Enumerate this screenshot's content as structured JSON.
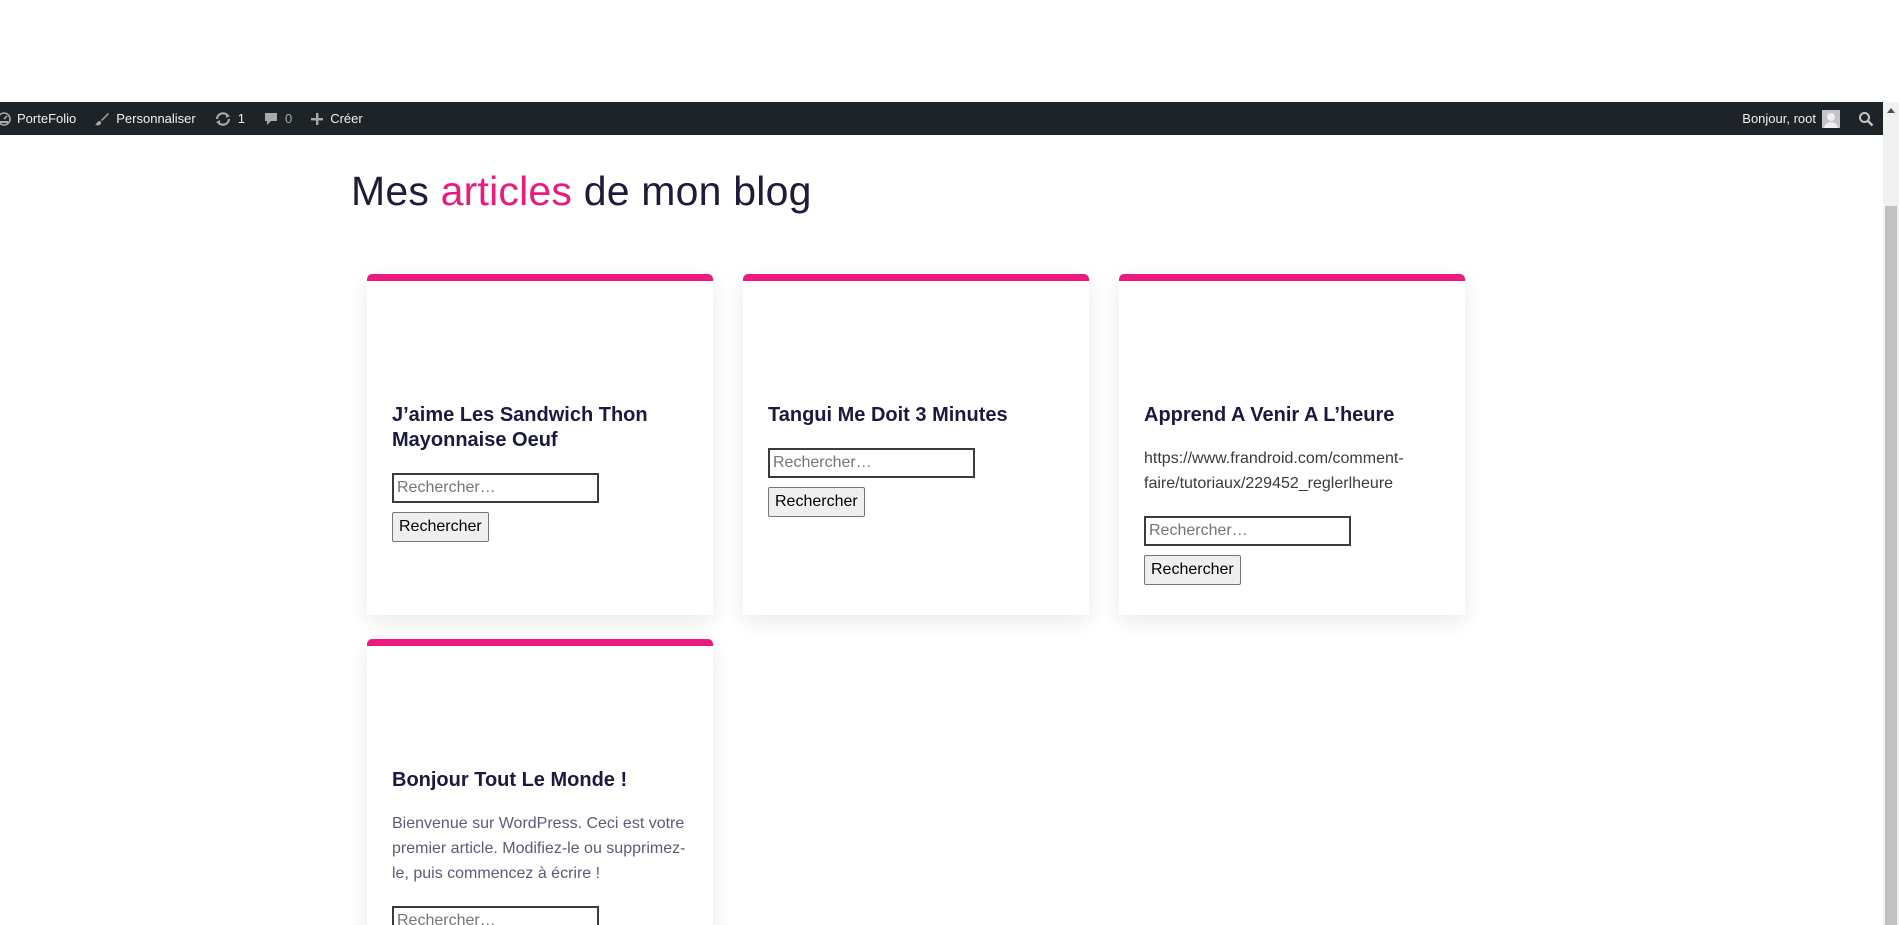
{
  "adminbar": {
    "site_name": "PorteFolio",
    "customize": "Personnaliser",
    "updates_count": "1",
    "comments_count": "0",
    "new": "Créer",
    "greeting": "Bonjour, root"
  },
  "page": {
    "title_prefix": "Mes ",
    "title_accent": "articles",
    "title_suffix": " de mon blog",
    "accent_color": "#ec1a7e"
  },
  "posts": [
    {
      "title": "J’aime Les Sandwich Thon Mayonnaise Oeuf",
      "excerpt": "",
      "search_placeholder": "Rechercher…",
      "search_button": "Rechercher"
    },
    {
      "title": "Tangui Me Doit 3 Minutes",
      "excerpt": "",
      "search_placeholder": "Rechercher…",
      "search_button": "Rechercher"
    },
    {
      "title": "Apprend A Venir A L’heure",
      "excerpt": "https://www.frandroid.com/comment-faire/tutoriaux/229452_reglerlheure",
      "search_placeholder": "Rechercher…",
      "search_button": "Rechercher"
    },
    {
      "title": "Bonjour Tout Le Monde !",
      "excerpt": "Bienvenue sur WordPress. Ceci est votre premier article. Modifiez-le ou supprimez-le, puis commencez à écrire !",
      "search_placeholder": "Rechercher…"
    }
  ],
  "icons": {
    "site": "dashboard-icon",
    "customize": "brush-icon",
    "updates": "update-icon",
    "comments": "comment-icon",
    "new": "plus-icon",
    "search": "search-icon"
  }
}
